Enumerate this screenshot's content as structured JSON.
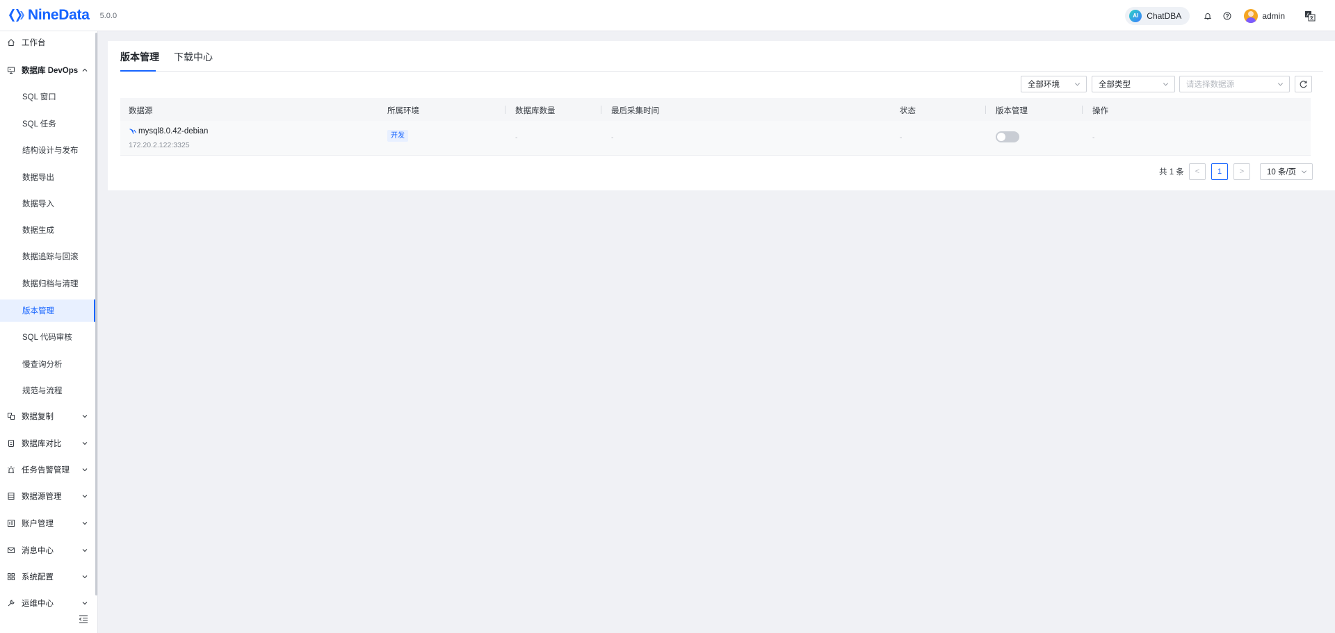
{
  "app": {
    "brand": "NineData",
    "version": "5.0.0",
    "accent": "#1664ff"
  },
  "header": {
    "ai_badge": "AI",
    "chatdba_label": "ChatDBA",
    "username": "admin",
    "icons": [
      "bell-icon",
      "help-icon",
      "avatar",
      "translate-icon"
    ]
  },
  "sidebar": {
    "items": [
      {
        "label": "工作台",
        "icon": "home-icon"
      },
      {
        "label": "数据库 DevOps",
        "icon": "devops-icon",
        "expanded": true
      },
      {
        "label": "SQL 窗口"
      },
      {
        "label": "SQL 任务"
      },
      {
        "label": "结构设计与发布"
      },
      {
        "label": "数据导出"
      },
      {
        "label": "数据导入"
      },
      {
        "label": "数据生成"
      },
      {
        "label": "数据追踪与回滚"
      },
      {
        "label": "数据归档与清理"
      },
      {
        "label": "版本管理",
        "active": true
      },
      {
        "label": "SQL 代码审核"
      },
      {
        "label": "慢查询分析"
      },
      {
        "label": "规范与流程"
      },
      {
        "label": "数据复制",
        "icon": "replication-icon"
      },
      {
        "label": "数据库对比",
        "icon": "compare-icon"
      },
      {
        "label": "任务告警管理",
        "icon": "alarm-icon"
      },
      {
        "label": "数据源管理",
        "icon": "datasource-icon"
      },
      {
        "label": "账户管理",
        "icon": "account-icon"
      },
      {
        "label": "消息中心",
        "icon": "mail-icon"
      },
      {
        "label": "系统配置",
        "icon": "grid-icon"
      },
      {
        "label": "运维中心",
        "icon": "tool-icon"
      }
    ]
  },
  "tabs": [
    {
      "label": "版本管理",
      "active": true
    },
    {
      "label": "下载中心",
      "active": false
    }
  ],
  "filters": {
    "env": "全部环境",
    "type": "全部类型",
    "datasource_placeholder": "请选择数据源"
  },
  "table": {
    "columns": [
      "数据源",
      "所属环境",
      "数据库数量",
      "最后采集时间",
      "状态",
      "版本管理",
      "操作"
    ],
    "rows": [
      {
        "name": "mysql8.0.42-debian",
        "host": "172.20.2.122:3325",
        "env": "开发",
        "db_count": "-",
        "last_collect": "-",
        "status": "-",
        "version_mgmt_enabled": false,
        "actions": "-"
      }
    ]
  },
  "pagination": {
    "total_text": "共 1 条",
    "prev": "<",
    "current_page": "1",
    "next": ">",
    "page_size": "10 条/页"
  }
}
